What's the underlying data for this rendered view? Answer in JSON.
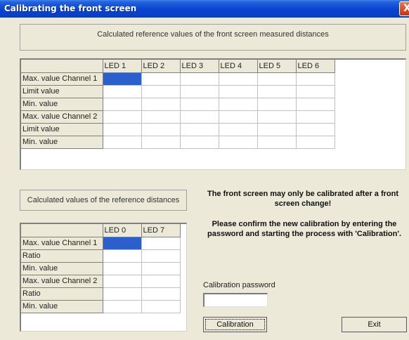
{
  "window": {
    "title": "Calibrating the front screen",
    "close_glyph": "X"
  },
  "top_section": {
    "header": "Calculated reference values of the front screen measured distances",
    "columns": [
      "LED 1",
      "LED 2",
      "LED 3",
      "LED 4",
      "LED 5",
      "LED 6"
    ],
    "rows": [
      {
        "label": "Max. value Channel 1"
      },
      {
        "label": "Limit value"
      },
      {
        "label": "Min. value"
      },
      {
        "label": "Max. value Channel 2"
      },
      {
        "label": "Limit value"
      },
      {
        "label": "Min. value"
      }
    ]
  },
  "bottom_section": {
    "header": "Calculated values of the reference distances",
    "columns": [
      "LED 0",
      "LED 7"
    ],
    "rows": [
      {
        "label": "Max. value Channel 1"
      },
      {
        "label": "Ratio"
      },
      {
        "label": "Min. value"
      },
      {
        "label": "Max. value Channel 2"
      },
      {
        "label": "Ratio"
      },
      {
        "label": "Min. value"
      }
    ]
  },
  "messages": {
    "warning": "The front screen may only be calibrated after a front screen change!",
    "confirm": "Please confirm the new calibration by entering the password and starting the process with 'Calibration'."
  },
  "password": {
    "label": "Calibration password",
    "value": ""
  },
  "buttons": {
    "calibration": "Calibration",
    "exit": "Exit"
  },
  "colors": {
    "selected_cell": "#2a5fcc",
    "title_bar": "#0a46d2",
    "window_bg": "#ece9d8"
  }
}
